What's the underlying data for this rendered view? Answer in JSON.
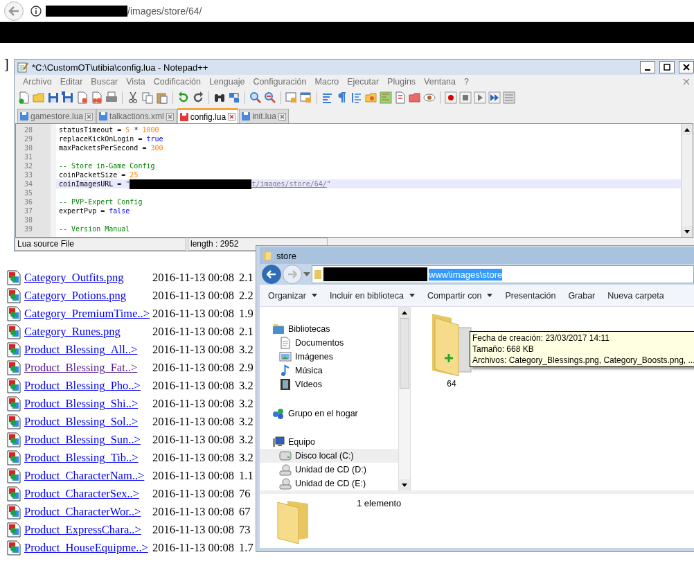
{
  "browser": {
    "url_path": "/images/store/64/"
  },
  "page": {
    "fragment": "]",
    "files": [
      {
        "name": "Category_Outfits.png",
        "date": "2016-11-13 00:08",
        "size": "2.1",
        "visited": false
      },
      {
        "name": "Category_Potions.png",
        "date": "2016-11-13 00:08",
        "size": "2.2",
        "visited": false
      },
      {
        "name": "Category_PremiumTime..>",
        "date": "2016-11-13 00:08",
        "size": "1.9",
        "visited": false
      },
      {
        "name": "Category_Runes.png",
        "date": "2016-11-13 00:08",
        "size": "2.1",
        "visited": false
      },
      {
        "name": "Product_Blessing_All..>",
        "date": "2016-11-13 00:08",
        "size": "3.2",
        "visited": false
      },
      {
        "name": "Product_Blessing_Fat..>",
        "date": "2016-11-13 00:08",
        "size": "2.9",
        "visited": true
      },
      {
        "name": "Product_Blessing_Pho..>",
        "date": "2016-11-13 00:08",
        "size": "3.2",
        "visited": false
      },
      {
        "name": "Product_Blessing_Shi..>",
        "date": "2016-11-13 00:08",
        "size": "3.2",
        "visited": false
      },
      {
        "name": "Product_Blessing_Sol..>",
        "date": "2016-11-13 00:08",
        "size": "3.2",
        "visited": false
      },
      {
        "name": "Product_Blessing_Sun..>",
        "date": "2016-11-13 00:08",
        "size": "3.2",
        "visited": false
      },
      {
        "name": "Product_Blessing_Tib..>",
        "date": "2016-11-13 00:08",
        "size": "3.2",
        "visited": false
      },
      {
        "name": "Product_CharacterNam..>",
        "date": "2016-11-13 00:08",
        "size": "1.1",
        "visited": false
      },
      {
        "name": "Product_CharacterSex..>",
        "date": "2016-11-13 00:08",
        "size": "76",
        "visited": false
      },
      {
        "name": "Product_CharacterWor..>",
        "date": "2016-11-13 00:08",
        "size": "67",
        "visited": false
      },
      {
        "name": "Product_ExpressChara..>",
        "date": "2016-11-13 00:08",
        "size": "73",
        "visited": false
      },
      {
        "name": "Product_HouseEquipme..>",
        "date": "2016-11-13 00:08",
        "size": "1.7",
        "visited": false
      }
    ]
  },
  "notepad": {
    "title": "*C:\\CustomOT\\utibia\\config.lua - Notepad++",
    "menu": [
      "Archivo",
      "Editar",
      "Buscar",
      "Vista",
      "Codificación",
      "Lenguaje",
      "Configuración",
      "Macro",
      "Ejecutar",
      "Plugins",
      "Ventana",
      "?"
    ],
    "tabs": [
      {
        "label": "gamestore.lua",
        "selected": false,
        "modified": false
      },
      {
        "label": "talkactions.xml",
        "selected": false,
        "modified": false
      },
      {
        "label": "config.lua",
        "selected": true,
        "modified": true
      },
      {
        "label": "init.lua",
        "selected": false,
        "modified": false
      }
    ],
    "code_lines": [
      {
        "number": "28",
        "current": false,
        "tokens": [
          {
            "kind": "ident",
            "text": "statusTimeout "
          },
          {
            "kind": "op",
            "text": "= "
          },
          {
            "kind": "number",
            "text": "5 "
          },
          {
            "kind": "op",
            "text": "* "
          },
          {
            "kind": "number",
            "text": "1000"
          }
        ]
      },
      {
        "number": "29",
        "current": false,
        "tokens": [
          {
            "kind": "ident",
            "text": "replaceKickOnLogin "
          },
          {
            "kind": "op",
            "text": "= "
          },
          {
            "kind": "keyword",
            "text": "true"
          }
        ]
      },
      {
        "number": "30",
        "current": false,
        "tokens": [
          {
            "kind": "ident",
            "text": "maxPacketsPerSecond "
          },
          {
            "kind": "op",
            "text": "= "
          },
          {
            "kind": "number",
            "text": "300"
          }
        ]
      },
      {
        "number": "31",
        "current": false
      },
      {
        "number": "32",
        "current": false,
        "tokens": [
          {
            "kind": "comment",
            "text": "-- Store in-Game Config"
          }
        ]
      },
      {
        "number": "33",
        "current": false,
        "tokens": [
          {
            "kind": "ident",
            "text": "coinPacketSize "
          },
          {
            "kind": "op",
            "text": "= "
          },
          {
            "kind": "number",
            "text": "25"
          }
        ]
      },
      {
        "number": "34",
        "current": true,
        "tokens": [
          {
            "kind": "ident",
            "text": "coinImagesURL "
          },
          {
            "kind": "op",
            "text": "= "
          },
          {
            "kind": "string",
            "text": "\""
          },
          {
            "kind": "redacted"
          },
          {
            "kind": "url",
            "text": "t/images/store/64/"
          },
          {
            "kind": "string",
            "text": "\""
          }
        ]
      },
      {
        "number": "35",
        "current": false
      },
      {
        "number": "36",
        "current": false,
        "tokens": [
          {
            "kind": "comment",
            "text": "-- PVP-Expert Config"
          }
        ]
      },
      {
        "number": "37",
        "current": false,
        "tokens": [
          {
            "kind": "ident",
            "text": "expertPvp "
          },
          {
            "kind": "op",
            "text": "= "
          },
          {
            "kind": "keyword",
            "text": "false"
          }
        ]
      },
      {
        "number": "38",
        "current": false
      },
      {
        "number": "39",
        "current": false,
        "tokens": [
          {
            "kind": "comment",
            "text": "-- Version Manual"
          }
        ]
      }
    ],
    "status_bar": [
      "Lua source File",
      "length : 2952"
    ]
  },
  "explorer": {
    "title": "store",
    "address": "www\\images\\store",
    "address_selected": true,
    "commands": [
      {
        "label": "Organizar",
        "dropdown": true
      },
      {
        "label": "Incluir en biblioteca",
        "dropdown": true
      },
      {
        "label": "Compartir con",
        "dropdown": true
      },
      {
        "label": "Presentación",
        "dropdown": false
      },
      {
        "label": "Grabar",
        "dropdown": false
      },
      {
        "label": "Nueva carpeta",
        "dropdown": false
      }
    ],
    "nav": [
      {
        "label": "Bibliotecas",
        "kind": "library",
        "selected": false,
        "children": [
          {
            "label": "Documentos",
            "kind": "documents",
            "selected": false
          },
          {
            "label": "Imágenes",
            "kind": "pictures",
            "selected": false
          },
          {
            "label": "Música",
            "kind": "music",
            "selected": false
          },
          {
            "label": "Vídeos",
            "kind": "videos",
            "selected": false
          }
        ]
      },
      {
        "label": "Grupo en el hogar",
        "kind": "homegroup",
        "selected": false
      },
      {
        "label": "Equipo",
        "kind": "computer",
        "selected": false,
        "children": [
          {
            "label": "Disco local (C:)",
            "kind": "drive",
            "selected": true
          },
          {
            "label": "Unidad de CD (D:)",
            "kind": "cd",
            "selected": false
          },
          {
            "label": "Unidad de CD (E:)",
            "kind": "cd",
            "selected": false
          }
        ]
      }
    ],
    "items": [
      {
        "label": "64"
      }
    ],
    "tooltip": [
      "Fecha de creación: 23/03/2017 14:11",
      "Tamaño: 668 KB",
      "Archivos: Category_Blessings.png, Category_Boosts.png, ..."
    ],
    "details": "1 elemento"
  }
}
